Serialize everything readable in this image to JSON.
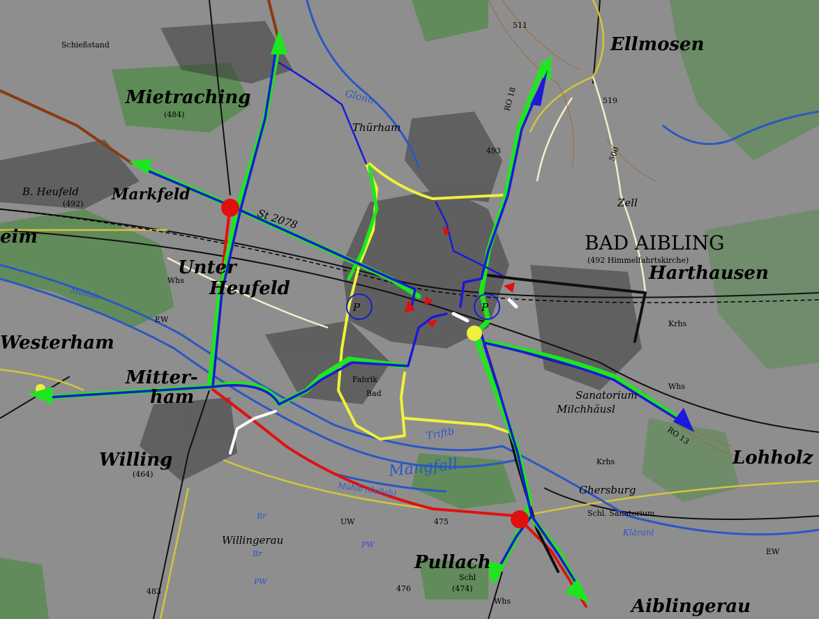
{
  "map": {
    "places": {
      "ellmosen": "Ellmosen",
      "mietraching": "Mietraching",
      "mietraching_elev": "(484)",
      "thurham": "Thürham",
      "markfeld": "Markfeld",
      "bheufeld": "B. Heufeld",
      "bheufeld_elev": "(492)",
      "unter": "Unter",
      "heufeld": "Heufeld",
      "westerham": "Westerham",
      "mitter": "Mitter-",
      "ham": "ham",
      "willing": "Willing",
      "willing_elev": "(464)",
      "willingerau": "Willingerau",
      "pullach": "Pullach",
      "pullach_elev": "(474)",
      "bad_aibling": "BAD AIBLING",
      "himmelfahrt": "(492 Himmelfahrtskirche)",
      "harthausen": "Harthausen",
      "zell": "Zell",
      "lohholz": "Lohholz",
      "aiblingerau": "Aiblingerau",
      "sanatorium": "Sanatorium",
      "milchhausl": "Milchhäusl",
      "ghersburg": "Ghersburg",
      "schl_sanatorium": "Schl. Sanatorium",
      "klaranl": "Kläranl",
      "schiessstand": "Schießstand",
      "fabrik": "Fabrik",
      "bad_small": "Bad"
    },
    "roads": {
      "st2078": "St 2078",
      "ro18": "RO 18",
      "ro13": "RO 13"
    },
    "water": {
      "mangfall": "Mangfall",
      "glonn": "Glonn",
      "triftb": "Triftb",
      "muhlb": "Mühlb (Gollab)",
      "madau": "Madau"
    },
    "misc": {
      "whs": "Whs",
      "krhs": "Krhs",
      "ew": "EW",
      "uw": "UW",
      "pw": "PW",
      "br": "Br",
      "schl": "Schl",
      "elev_475": "475",
      "elev_476": "476",
      "elev_483": "483",
      "elev_493": "493",
      "elev_511": "511",
      "elev_519": "519",
      "elev_500": "500",
      "heim": "eim"
    },
    "colors": {
      "background": "#8e8e8e",
      "forest": "#4e8a45",
      "river": "#2a57c4",
      "route_green": "#1ee61e",
      "route_blue": "#1a1ad8",
      "route_yellow": "#f0f03c",
      "route_red": "#e01010",
      "route_black": "#101010",
      "route_white": "#ffffff"
    }
  }
}
